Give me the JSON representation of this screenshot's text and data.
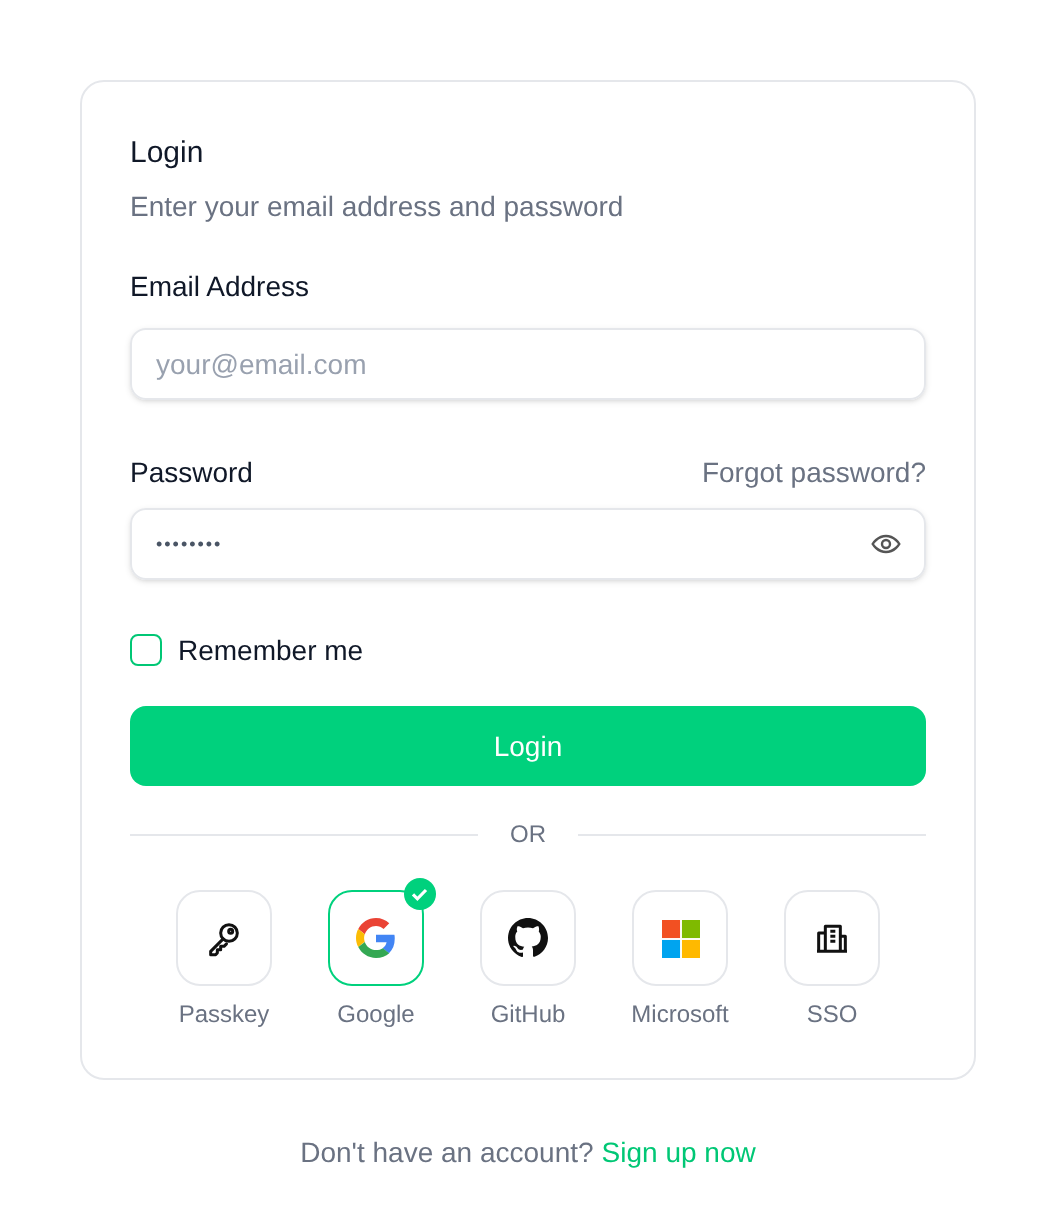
{
  "title": "Login",
  "subtitle": "Enter your email address and password",
  "email": {
    "label": "Email Address",
    "placeholder": "your@email.com"
  },
  "password": {
    "label": "Password",
    "forgot": "Forgot password?",
    "value": "••••••••"
  },
  "remember": {
    "label": "Remember me",
    "checked": false
  },
  "submit": "Login",
  "divider": "OR",
  "providers": [
    {
      "kind": "passkey",
      "label": "Passkey",
      "selected": false
    },
    {
      "kind": "google",
      "label": "Google",
      "selected": true
    },
    {
      "kind": "github",
      "label": "GitHub",
      "selected": false
    },
    {
      "kind": "microsoft",
      "label": "Microsoft",
      "selected": false
    },
    {
      "kind": "sso",
      "label": "SSO",
      "selected": false
    }
  ],
  "footer": {
    "text": "Don't have an account?",
    "link": "Sign up now"
  }
}
